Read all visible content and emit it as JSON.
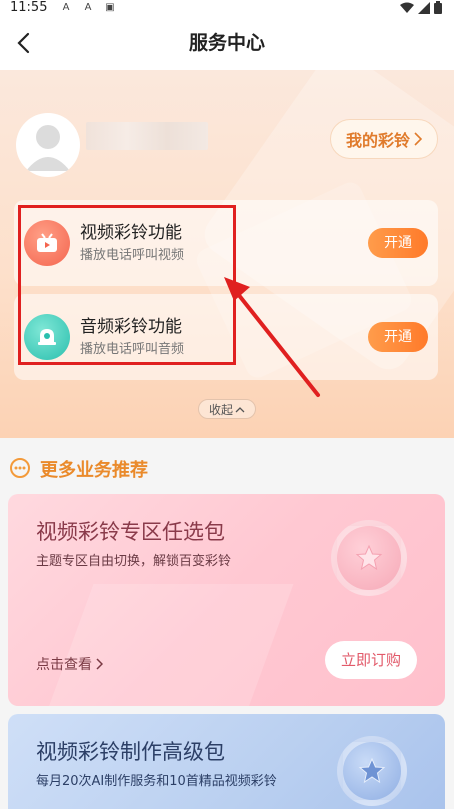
{
  "status": {
    "time": "11:55",
    "notifications": [
      "A",
      "A",
      "▣"
    ]
  },
  "nav": {
    "title": "服务中心"
  },
  "profile": {
    "my_ring_label": "我的彩铃"
  },
  "features": [
    {
      "title": "视频彩铃功能",
      "subtitle": "播放电话呼叫视频",
      "button": "开通"
    },
    {
      "title": "音频彩铃功能",
      "subtitle": "播放电话呼叫音频",
      "button": "开通"
    }
  ],
  "collapse_label": "收起",
  "recommend": {
    "title": "更多业务推荐",
    "packages": [
      {
        "title": "视频彩铃专区任选包",
        "subtitle": "主题专区自由切换，解锁百变彩铃",
        "link": "点击查看",
        "button": "立即订购"
      },
      {
        "title": "视频彩铃制作高级包",
        "subtitle": "每月20次AI制作服务和10首精品视频彩铃"
      }
    ]
  },
  "colors": {
    "accent": "#ea8a2b",
    "button": "#ff7a2a",
    "highlight": "#e02020"
  }
}
